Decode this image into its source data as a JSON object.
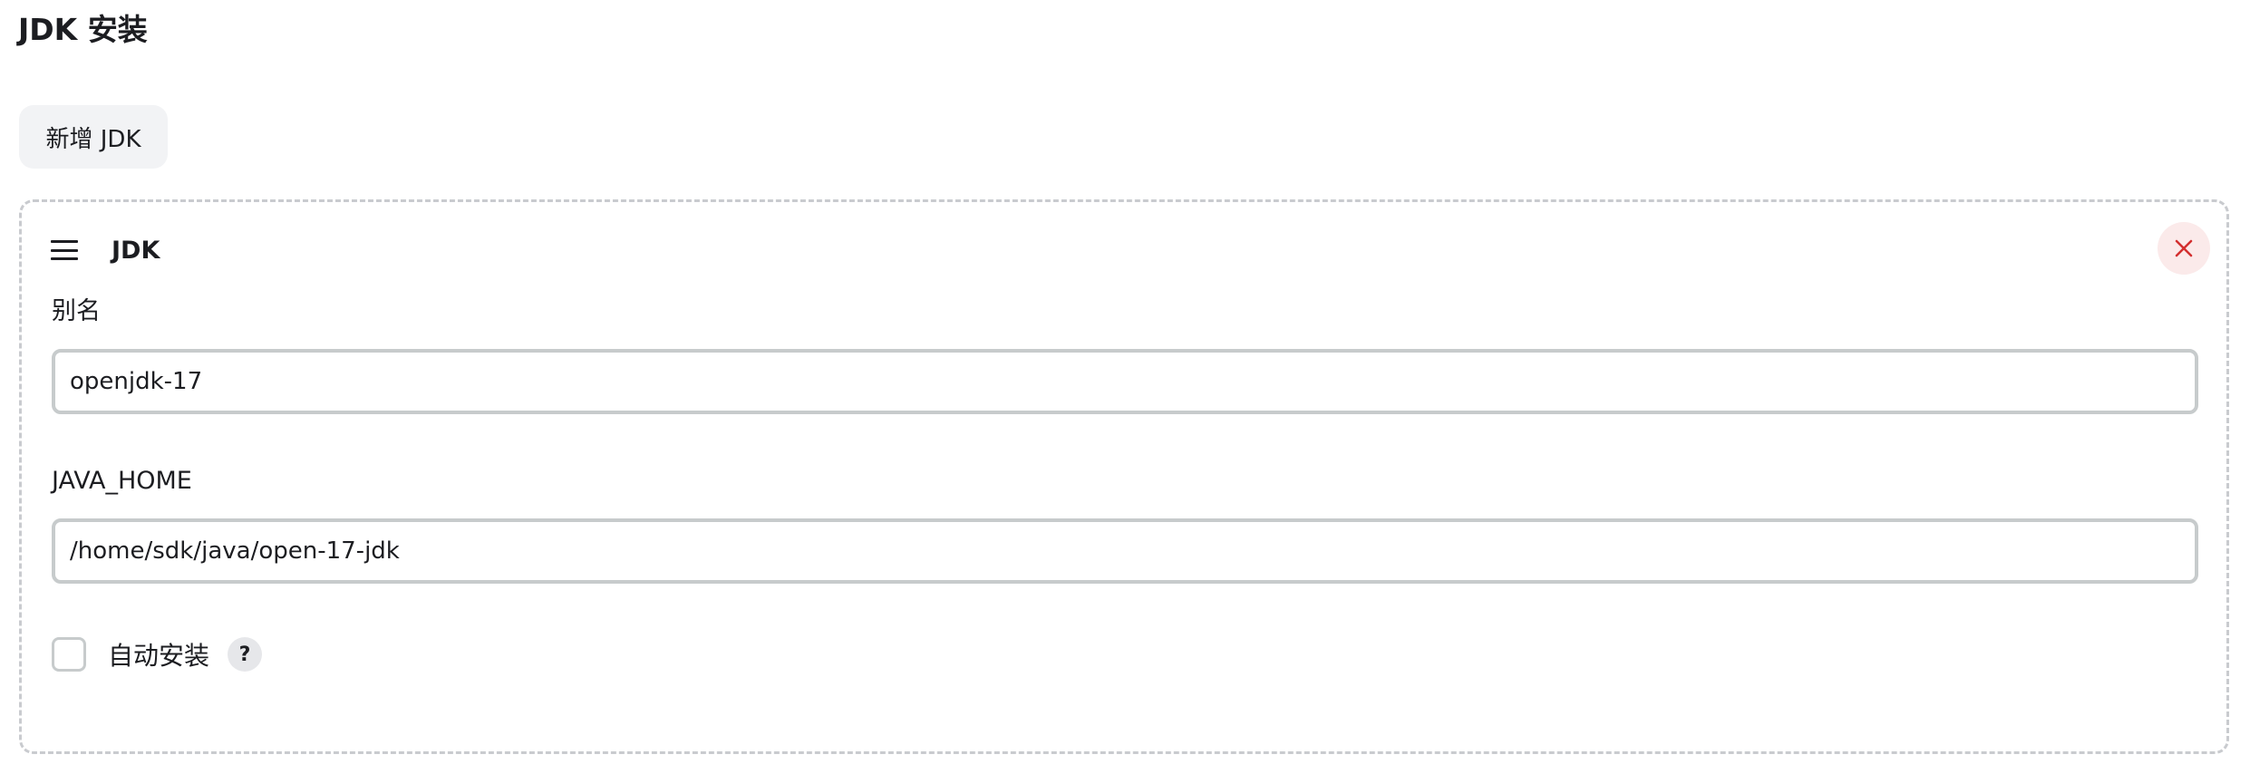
{
  "section": {
    "title": "JDK 安装"
  },
  "add_button": {
    "label": "新增 JDK"
  },
  "jdk_entry": {
    "title": "JDK",
    "fields": {
      "name": {
        "label": "别名",
        "value": "openjdk-17"
      },
      "java_home": {
        "label": "JAVA_HOME",
        "value": "/home/sdk/java/open-17-jdk"
      }
    },
    "auto_install": {
      "label": "自动安装",
      "checked": false,
      "help": "?"
    }
  },
  "icons": {
    "drag": "drag-handle-icon",
    "delete": "close-icon",
    "help": "help-icon"
  },
  "colors": {
    "delete_icon": "#d32f2f",
    "delete_bg": "#fbeaea",
    "input_border": "#c7cbcc",
    "button_bg": "#f2f3f5",
    "dashed_border": "#c9cbcf"
  }
}
